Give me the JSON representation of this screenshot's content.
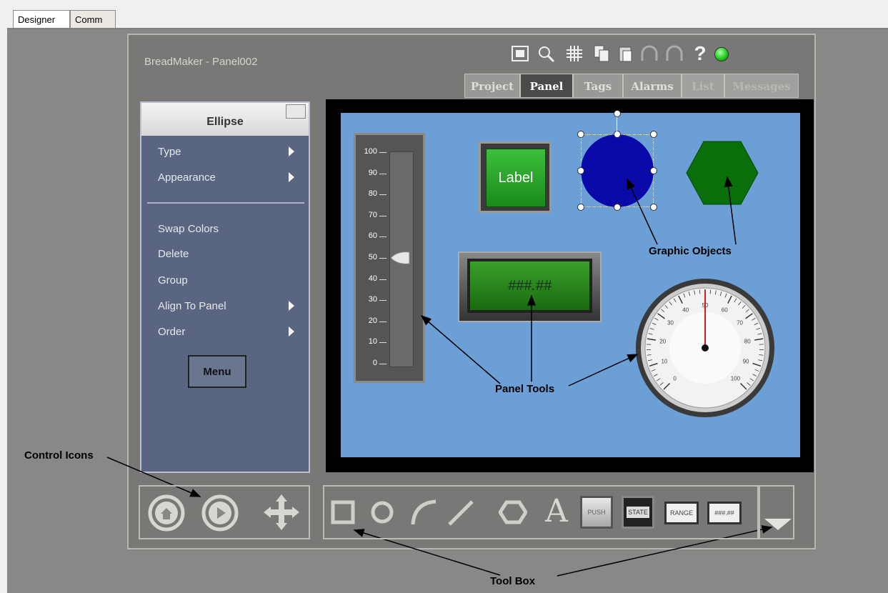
{
  "outer_tabs": [
    "Designer",
    "Comm"
  ],
  "app": {
    "title": "BreadMaker - Panel002",
    "header_icons": [
      "fit-screen-icon",
      "zoom-icon",
      "grid-icon",
      "copy-icon",
      "paste-icon",
      "undo-icon",
      "redo-icon",
      "help-icon",
      "status-indicator-icon"
    ],
    "tabs": [
      "Project",
      "Panel",
      "Tags",
      "Alarms",
      "List",
      "Messages"
    ],
    "active_tab": "Panel",
    "status_color": "#22cc22"
  },
  "properties": {
    "title": "Ellipse",
    "items_top": [
      {
        "label": "Type",
        "submenu": true
      },
      {
        "label": "Appearance",
        "submenu": true
      }
    ],
    "items_bottom": [
      {
        "label": "Swap Colors",
        "submenu": false
      },
      {
        "label": "Delete",
        "submenu": false
      },
      {
        "label": "Group",
        "submenu": false
      },
      {
        "label": "Align To Panel",
        "submenu": true
      },
      {
        "label": "Order",
        "submenu": true
      }
    ],
    "menu_button": "Menu"
  },
  "canvas": {
    "slider_ticks": [
      "100",
      "90",
      "80",
      "70",
      "60",
      "50",
      "40",
      "30",
      "20",
      "10",
      "0"
    ],
    "slider_value": 50,
    "label_button": "Label",
    "numeric_display": "###.##",
    "gauge_ticks": [
      "0",
      "10",
      "20",
      "30",
      "40",
      "50",
      "60",
      "70",
      "80",
      "90",
      "100"
    ],
    "gauge_value": 50,
    "colors": {
      "ellipse": "#0a0a9c",
      "hexagon": "#0a6e0a",
      "label_button": "#2a9a2a",
      "display": "#2a8a1a"
    }
  },
  "control_icons": [
    "home-icon",
    "play-icon",
    "move-icon"
  ],
  "toolbox": {
    "shape_tools": [
      "rectangle-tool-icon",
      "ellipse-tool-icon",
      "arc-tool-icon",
      "line-tool-icon",
      "polygon-tool-icon",
      "text-tool-icon"
    ],
    "text_tool_glyph": "A",
    "panel_tools": [
      "PUSH",
      "STATE",
      "RANGE",
      "###.##"
    ]
  },
  "annotations": {
    "graphic_objects": "Graphic Objects",
    "panel_tools": "Panel Tools",
    "control_icons": "Control Icons",
    "tool_box": "Tool Box"
  }
}
